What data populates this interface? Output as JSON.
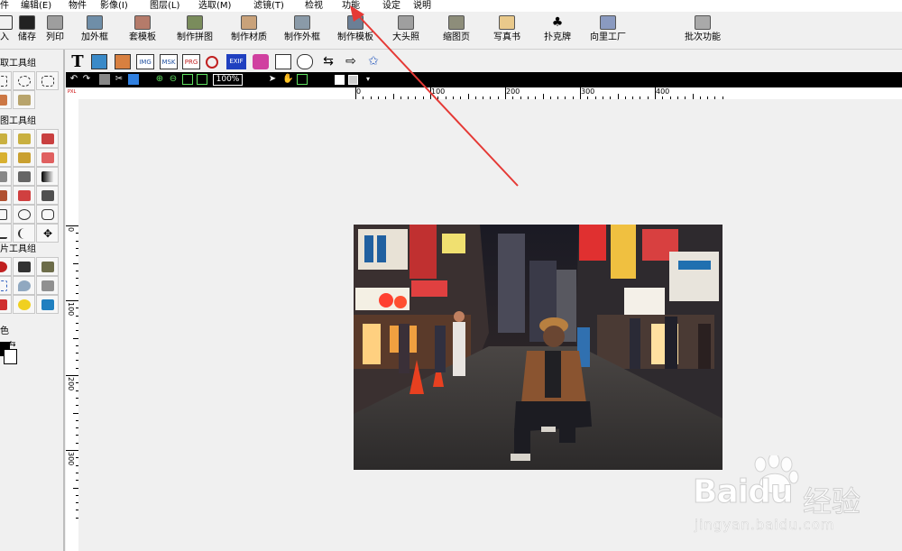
{
  "menu": [
    {
      "key": "file",
      "label": "件"
    },
    {
      "key": "edit",
      "label": "编辑(E)"
    },
    {
      "key": "object",
      "label": "物件"
    },
    {
      "key": "image",
      "label": "影像(I)"
    },
    {
      "key": "layer",
      "label": "图层(L)"
    },
    {
      "key": "select",
      "label": "选取(M)"
    },
    {
      "key": "filter",
      "label": "滤镜(T)"
    },
    {
      "key": "view",
      "label": "检视"
    },
    {
      "key": "function",
      "label": "功能"
    },
    {
      "key": "settings",
      "label": "设定"
    },
    {
      "key": "help",
      "label": "说明"
    }
  ],
  "toolbar": [
    {
      "key": "import",
      "label": "入"
    },
    {
      "key": "save",
      "label": "储存"
    },
    {
      "key": "print",
      "label": "列印"
    },
    {
      "key": "add-frame",
      "label": "加外框"
    },
    {
      "key": "template",
      "label": "套模板"
    },
    {
      "key": "collage",
      "label": "制作拼图"
    },
    {
      "key": "material",
      "label": "制作材质"
    },
    {
      "key": "make-frame",
      "label": "制作外框"
    },
    {
      "key": "make-template",
      "label": "制作模板"
    },
    {
      "key": "id-photo",
      "label": "大头照"
    },
    {
      "key": "thumbnail",
      "label": "缩图页"
    },
    {
      "key": "photobook",
      "label": "写真书"
    },
    {
      "key": "poker",
      "label": "扑克牌"
    },
    {
      "key": "wizard",
      "label": "向里工厂"
    },
    {
      "key": "batch",
      "label": "批次功能"
    }
  ],
  "panel": {
    "group1": "取工具组",
    "group2": "图工具组",
    "group3": "片工具组",
    "color_label": "色"
  },
  "object_toolbar": {
    "text_tool": "T",
    "img": "IMG",
    "msk": "MSK",
    "prg": "PRG",
    "exif": "EXIF"
  },
  "view_toolbar": {
    "zoom": "100%"
  },
  "ruler": {
    "h_labels": [
      "0",
      "100",
      "200",
      "300",
      "400"
    ],
    "v_labels": [
      "0",
      "100",
      "200",
      "300"
    ],
    "corner": "PXL"
  },
  "watermark": {
    "brand": "Baidu",
    "cn": "经验",
    "url": "jingyan.baidu.com"
  },
  "colors": {
    "accent_red": "#e53935",
    "ruler_bg": "#ffffff",
    "view_bar": "#000000"
  }
}
